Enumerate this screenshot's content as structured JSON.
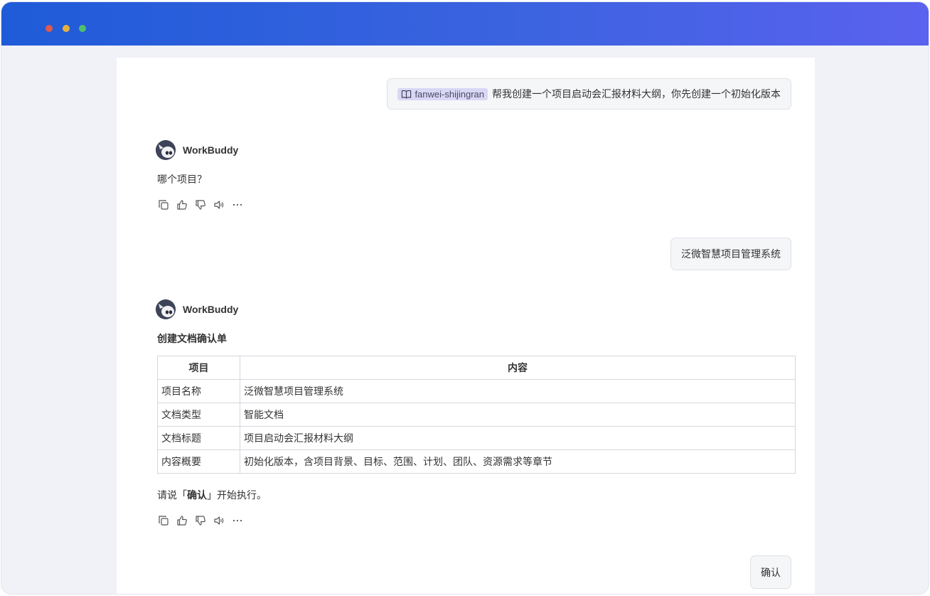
{
  "window": {
    "controls": [
      "close",
      "minimize",
      "maximize"
    ]
  },
  "messages": [
    {
      "role": "user",
      "tag": "fanwei-shijingran",
      "text": "帮我创建一个项目启动会汇报材料大纲，你先创建一个初始化版本"
    },
    {
      "role": "bot",
      "name": "WorkBuddy",
      "text": "哪个项目？"
    },
    {
      "role": "user",
      "text": "泛微智慧项目管理系统"
    },
    {
      "role": "bot",
      "name": "WorkBuddy",
      "doc_title": "创建文档确认单",
      "table": {
        "headers": [
          "项目",
          "内容"
        ],
        "rows": [
          [
            "项目名称",
            "泛微智慧项目管理系统"
          ],
          [
            "文档类型",
            "智能文档"
          ],
          [
            "文档标题",
            "项目启动会汇报材料大纲"
          ],
          [
            "内容概要",
            "初始化版本，含项目背景、目标、范围、计划、团队、资源需求等章节"
          ]
        ]
      },
      "note_prefix": "请说「",
      "note_bold": "确认",
      "note_suffix": "」开始执行。"
    },
    {
      "role": "user",
      "text": "确认"
    }
  ],
  "actions": [
    "copy-icon",
    "thumbs-up-icon",
    "thumbs-down-icon",
    "speaker-icon",
    "more-icon"
  ],
  "colors": {
    "titlebar_start": "#1f5bd8",
    "titlebar_end": "#5a62ee",
    "tag_bg": "#d9d7f5"
  }
}
